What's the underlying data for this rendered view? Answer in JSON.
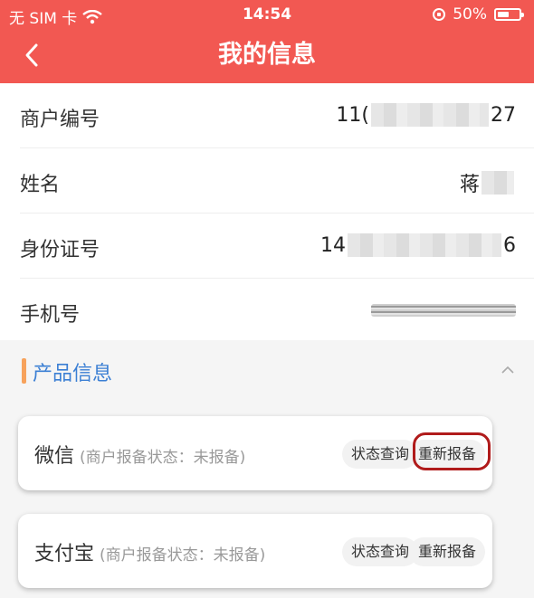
{
  "status_bar": {
    "carrier": "无 SIM 卡",
    "time": "14:54",
    "battery": "50%",
    "battery_level": 0.5
  },
  "nav": {
    "title": "我的信息"
  },
  "info_rows": [
    {
      "label": "商户编号",
      "value_left": "11(",
      "value_right": "27"
    },
    {
      "label": "姓名",
      "value_left": "蒋",
      "value_right": ""
    },
    {
      "label": "身份证号",
      "value_left": "14",
      "value_right": "6"
    },
    {
      "label": "手机号",
      "value_left": "",
      "value_right": ""
    }
  ],
  "section": {
    "title": "产品信息"
  },
  "products": [
    {
      "name": "微信",
      "status": "(商户报备状态：未报备)",
      "query_label": "状态查询",
      "rereport_label": "重新报备",
      "highlighted": true
    },
    {
      "name": "支付宝",
      "status": "(商户报备状态：未报备)",
      "query_label": "状态查询",
      "rereport_label": "重新报备",
      "highlighted": false
    }
  ],
  "colors": {
    "header": "#f25852",
    "section_title": "#3b7fd4",
    "section_bar": "#f7a25c",
    "highlight": "#b01b1b"
  }
}
